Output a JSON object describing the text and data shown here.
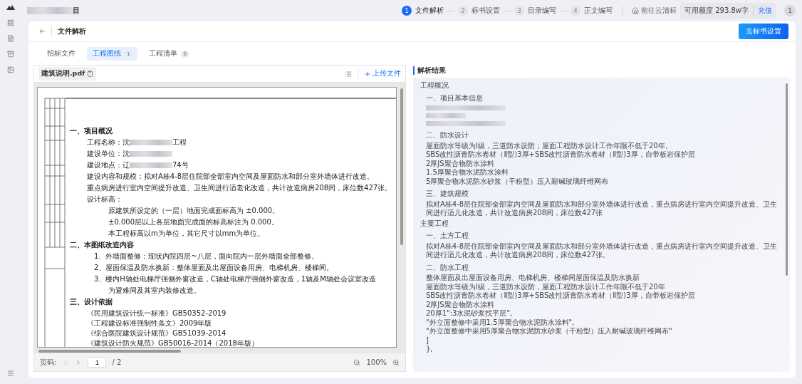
{
  "header": {
    "title_suffix": "目",
    "steps": [
      {
        "number": "1",
        "label": "文件解析",
        "selected": true
      },
      {
        "number": "2",
        "label": "标书设置",
        "selected": false
      },
      {
        "number": "3",
        "label": "目录编写",
        "selected": false
      },
      {
        "number": "4",
        "label": "正文编写",
        "selected": false
      }
    ],
    "cloud_link": "前往云清标",
    "quota_label": "可用额度",
    "quota_value": "293.8w字",
    "recharge": "充值",
    "avatar": "1"
  },
  "card": {
    "title": "文件解析",
    "action": "去标书设置",
    "tabs": [
      {
        "label": "招标文件",
        "selected": false
      },
      {
        "label": "工程图纸",
        "count": "1",
        "selected": true
      },
      {
        "label": "工程清单",
        "count": "0",
        "selected": false
      }
    ]
  },
  "viewer": {
    "file_name": "建筑说明.pdf",
    "upload": "上传文件",
    "document": [
      {
        "kind": "heading",
        "text": "一、项目概况"
      },
      {
        "kind": "field",
        "text": "工程名称：沈",
        "suffix": "工程"
      },
      {
        "kind": "field",
        "text": "建设单位：沈"
      },
      {
        "kind": "field",
        "text": "建设地点：辽",
        "suffix": "74号"
      },
      {
        "kind": "para",
        "text": "建设内容和规模：拟对A栋4-8层住院部全部室内空间及屋面防水和部分室外墙体进行改造。"
      },
      {
        "kind": "para",
        "text": "重点病房进行室内空间提升改造、卫生间进行适老化改造，共计改造病房208间，床位数427张。"
      },
      {
        "kind": "para",
        "text": "设计标高："
      },
      {
        "kind": "sub",
        "text": "原建筑所设定的（一层）地面完成面标高为 ±0.000。"
      },
      {
        "kind": "sub",
        "text": "±0.000层以上各层地面完成面的标高标注为 0.000。"
      },
      {
        "kind": "sub",
        "text": "本工程标高以m为单位，其它尺寸以mm为单位。"
      },
      {
        "kind": "heading",
        "text": "二、本图纸改造内容"
      },
      {
        "kind": "item",
        "text": "1、外墙面整修：现状内院四层~八层，面向院内一层外墙面全部整修。"
      },
      {
        "kind": "item",
        "text": "2、屋面保温及防水换新：整体屋面及出屋面设备用房、电梯机房、楼梯间。"
      },
      {
        "kind": "item",
        "text": "3、楼内H轴处电梯厅强侧外窗改造，C轴处电梯厅强侧外窗改造，1轴及M轴处会议室改造"
      },
      {
        "kind": "sub",
        "text": "为避难间及其室内装修改造。"
      },
      {
        "kind": "heading",
        "text": "三、设计依据"
      },
      {
        "kind": "ref",
        "text": "《民用建筑设计统一标准》GB50352-2019"
      },
      {
        "kind": "ref",
        "text": "《工程建设标准强制性条文》2009年版"
      },
      {
        "kind": "ref",
        "text": "《综合医院建筑设计规范》GB51039-2014"
      },
      {
        "kind": "ref",
        "text": "《建筑设计防火规范》GB50016-2014（2018年版）"
      }
    ],
    "page_label": "页码:",
    "page": "1",
    "page_total": "/ 2",
    "zoom": "100%"
  },
  "result": {
    "title": "解析结果",
    "lines": [
      {
        "kind": "h1",
        "text": "工程概况"
      },
      {
        "kind": "h2",
        "text": "一、项目基本信息"
      },
      {
        "kind": "blur"
      },
      {
        "kind": "blur"
      },
      {
        "kind": "blur"
      },
      {
        "kind": "h2",
        "text": "二、防水设计"
      },
      {
        "kind": "p",
        "text": "屋面防水等级为I级，三道防水设防；屋面工程防水设计工作年限不低于20年。"
      },
      {
        "kind": "p",
        "text": "SBS改性沥青防水卷材（Ⅱ型)3厚+SBS改性沥青防水卷材（Ⅱ型)3厚，自带板岩保护层"
      },
      {
        "kind": "p",
        "text": "2厚JS聚合物防水涂料"
      },
      {
        "kind": "p",
        "text": "1.5厚聚合物水泥防水涂料"
      },
      {
        "kind": "p",
        "text": "5厚聚合物水泥防水砂浆（干粉型）压入耐碱玻璃纤维网布"
      },
      {
        "kind": "h2",
        "text": "三、建筑规模"
      },
      {
        "kind": "p",
        "text": "拟对A栋4-8层住院部全部室内空间及屋面防水和部分室外墙体进行改造，重点病房进行室内空间提升改造、卫生间进行适儿化改造，共计改造病房208间，床位数427张"
      },
      {
        "kind": "h1",
        "text": "主要工程"
      },
      {
        "kind": "h2",
        "text": "一、土方工程"
      },
      {
        "kind": "p",
        "text": "拟对A栋4-8层住院部全部室内空间及屋面防水和部分室外墙体进行改造，重点病房进行室内空间提升改造、卫生间进行适儿化改造，共计改造病房208间，床位数427张。"
      },
      {
        "kind": "h2",
        "text": "二、防水工程"
      },
      {
        "kind": "p",
        "text": "整体屋面及出屋面设备用房、电梯机房、楼梯间屋面保温及防水换新"
      },
      {
        "kind": "p",
        "text": "屋面防水等级为I级，三道防水设防，屋面工程防水设计工作年限不低于20年"
      },
      {
        "kind": "p",
        "text": "SBS改性沥青防水卷材（Ⅱ型)3厚+SBS改性沥青防水卷材（Ⅱ型)3厚，自带板岩保护层"
      },
      {
        "kind": "p",
        "text": "2厚JS聚合物防水涂料"
      },
      {
        "kind": "p",
        "text": "20厚1\":3水泥砂浆找平层\","
      },
      {
        "kind": "p",
        "text": "\"外立面整修中采用1.5厚聚合物水泥防水涂料\","
      },
      {
        "kind": "p",
        "text": "\"外立面整修中采用5厚聚合物水泥防水砂浆（干粉型）压入耐碱玻璃纤维网布\""
      },
      {
        "kind": "p",
        "text": "]"
      },
      {
        "kind": "p",
        "text": "},"
      }
    ]
  }
}
